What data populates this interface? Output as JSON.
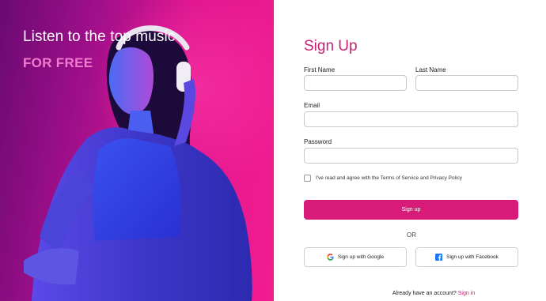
{
  "hero": {
    "title": "Listen to the top music",
    "subtitle": "FOR FREE"
  },
  "form": {
    "title": "Sign Up",
    "first_name_label": "First Name",
    "first_name_value": "",
    "last_name_label": "Last Name",
    "last_name_value": "",
    "email_label": "Email",
    "email_value": "",
    "password_label": "Password",
    "password_value": "",
    "terms_text": "I've read and agree with the Terms of Service and Privacy Policy",
    "terms_checked": false,
    "signup_button": "Sign up",
    "or_text": "OR",
    "google_button": "Sign up with Google",
    "google_icon": "google-icon",
    "facebook_button": "Sign up with Facebook",
    "facebook_icon": "facebook-icon",
    "already_text": "Already have an account?",
    "signin_link": "Sign in"
  },
  "colors": {
    "accent": "#d81a78",
    "hero_gradient_start": "#6a0a72",
    "hero_gradient_end": "#f21d8f",
    "subtitle": "#f07ccf"
  }
}
